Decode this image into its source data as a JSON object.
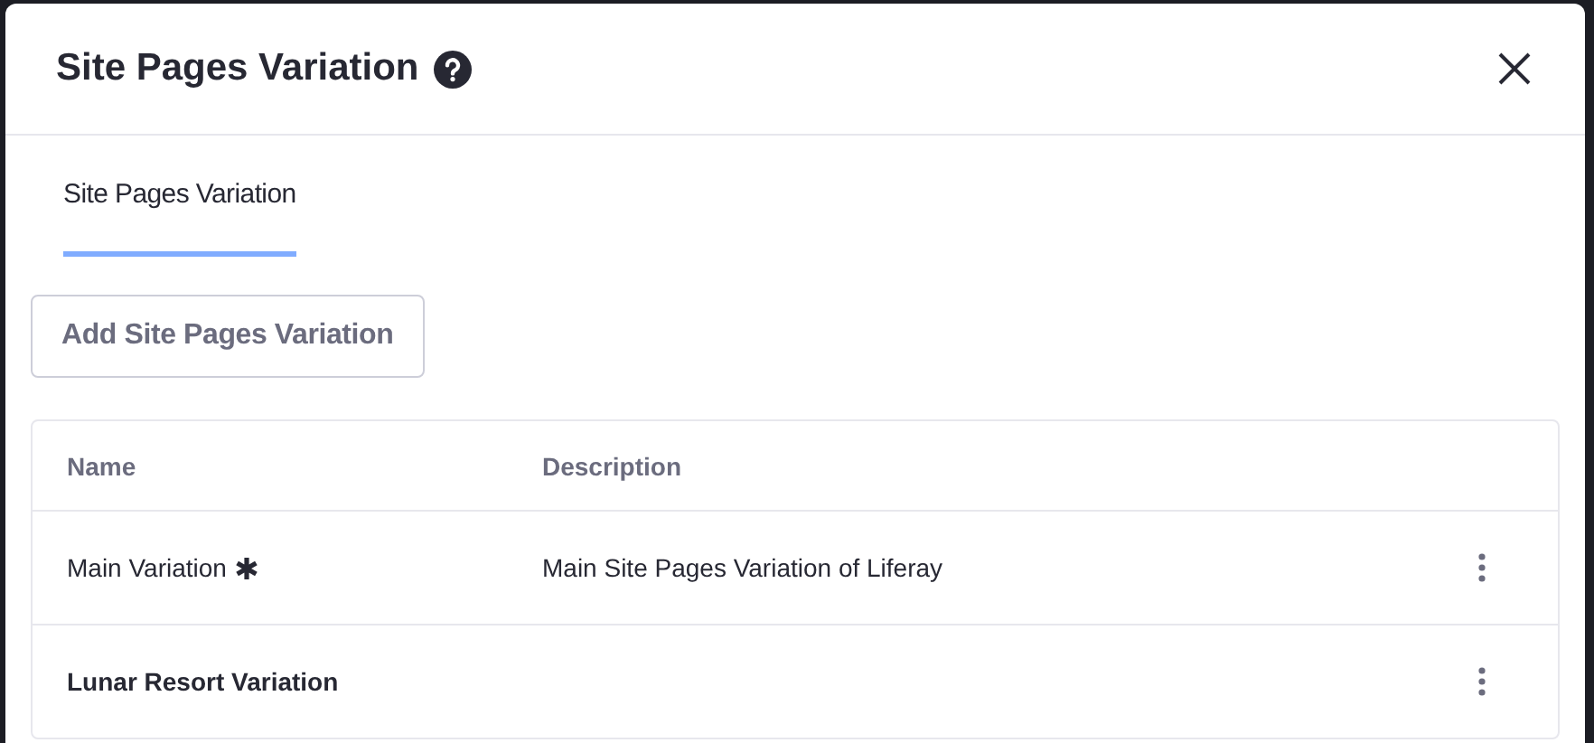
{
  "dialog": {
    "title": "Site Pages Variation"
  },
  "tabs": [
    {
      "label": "Site Pages Variation",
      "selected": true
    }
  ],
  "add_button": "Add Site Pages Variation",
  "table": {
    "columns": [
      "Name",
      "Description"
    ],
    "rows": [
      {
        "name": "Main Variation",
        "description": "Main Site Pages Variation of Liferay",
        "default": true,
        "bold": false
      },
      {
        "name": "Lunar Resort Variation",
        "default": false,
        "bold": true
      }
    ]
  }
}
